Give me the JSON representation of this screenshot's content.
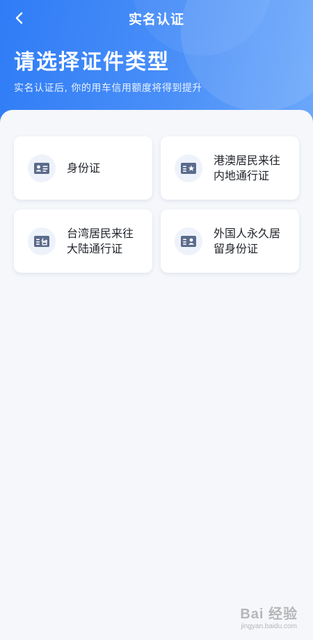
{
  "nav": {
    "title": "实名认证",
    "back_icon": "chevron-left-icon"
  },
  "hero": {
    "title": "请选择证件类型",
    "subtitle": "实名认证后, 你的用车信用额度将得到提升"
  },
  "id_types": [
    {
      "label": "身份证",
      "icon": "id-card-icon"
    },
    {
      "label": "港澳居民来往\n内地通行证",
      "icon": "hk-macau-permit-icon"
    },
    {
      "label": "台湾居民来往\n大陆通行证",
      "icon": "taiwan-permit-icon"
    },
    {
      "label": "外国人永久居\n留身份证",
      "icon": "foreigner-residence-card-icon"
    }
  ],
  "watermark": {
    "main": "Bai 经验",
    "sub": "jingyan.baidu.com"
  },
  "colors": {
    "header_gradient_start": "#2f7cf6",
    "header_gradient_end": "#6ba8fb",
    "icon_color": "#5b6b8c",
    "icon_bg": "#eef2fa"
  }
}
